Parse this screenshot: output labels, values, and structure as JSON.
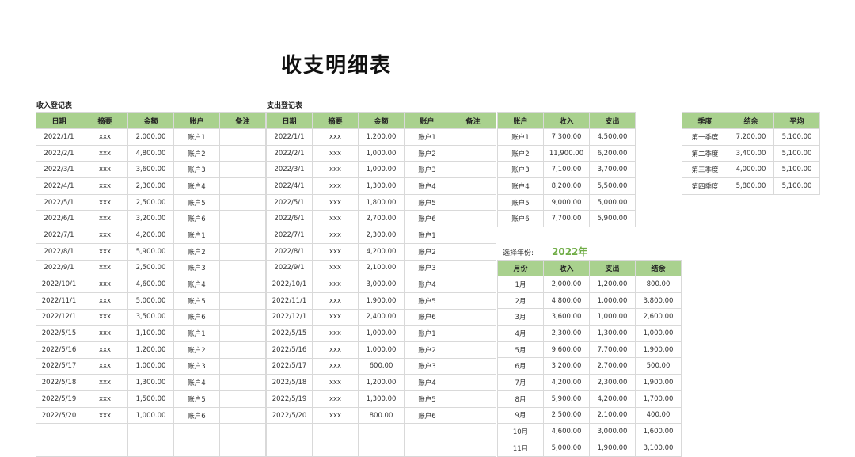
{
  "page_title": "收支明细表",
  "income_table": {
    "label": "收入登记表",
    "headers": [
      "日期",
      "摘要",
      "金额",
      "账户",
      "备注"
    ],
    "rows": [
      [
        "2022/1/1",
        "xxx",
        "2,000.00",
        "账户1",
        ""
      ],
      [
        "2022/2/1",
        "xxx",
        "4,800.00",
        "账户2",
        ""
      ],
      [
        "2022/3/1",
        "xxx",
        "3,600.00",
        "账户3",
        ""
      ],
      [
        "2022/4/1",
        "xxx",
        "2,300.00",
        "账户4",
        ""
      ],
      [
        "2022/5/1",
        "xxx",
        "2,500.00",
        "账户5",
        ""
      ],
      [
        "2022/6/1",
        "xxx",
        "3,200.00",
        "账户6",
        ""
      ],
      [
        "2022/7/1",
        "xxx",
        "4,200.00",
        "账户1",
        ""
      ],
      [
        "2022/8/1",
        "xxx",
        "5,900.00",
        "账户2",
        ""
      ],
      [
        "2022/9/1",
        "xxx",
        "2,500.00",
        "账户3",
        ""
      ],
      [
        "2022/10/1",
        "xxx",
        "4,600.00",
        "账户4",
        ""
      ],
      [
        "2022/11/1",
        "xxx",
        "5,000.00",
        "账户5",
        ""
      ],
      [
        "2022/12/1",
        "xxx",
        "3,500.00",
        "账户6",
        ""
      ],
      [
        "2022/5/15",
        "xxx",
        "1,100.00",
        "账户1",
        ""
      ],
      [
        "2022/5/16",
        "xxx",
        "1,200.00",
        "账户2",
        ""
      ],
      [
        "2022/5/17",
        "xxx",
        "1,000.00",
        "账户3",
        ""
      ],
      [
        "2022/5/18",
        "xxx",
        "1,300.00",
        "账户4",
        ""
      ],
      [
        "2022/5/19",
        "xxx",
        "1,500.00",
        "账户5",
        ""
      ],
      [
        "2022/5/20",
        "xxx",
        "1,000.00",
        "账户6",
        ""
      ],
      [
        "",
        "",
        "",
        "",
        ""
      ],
      [
        "",
        "",
        "",
        "",
        ""
      ]
    ]
  },
  "expense_table": {
    "label": "支出登记表",
    "headers": [
      "日期",
      "摘要",
      "金额",
      "账户",
      "备注"
    ],
    "rows": [
      [
        "2022/1/1",
        "xxx",
        "1,200.00",
        "账户1",
        ""
      ],
      [
        "2022/2/1",
        "xxx",
        "1,000.00",
        "账户2",
        ""
      ],
      [
        "2022/3/1",
        "xxx",
        "1,000.00",
        "账户3",
        ""
      ],
      [
        "2022/4/1",
        "xxx",
        "1,300.00",
        "账户4",
        ""
      ],
      [
        "2022/5/1",
        "xxx",
        "1,800.00",
        "账户5",
        ""
      ],
      [
        "2022/6/1",
        "xxx",
        "2,700.00",
        "账户6",
        ""
      ],
      [
        "2022/7/1",
        "xxx",
        "2,300.00",
        "账户1",
        ""
      ],
      [
        "2022/8/1",
        "xxx",
        "4,200.00",
        "账户2",
        ""
      ],
      [
        "2022/9/1",
        "xxx",
        "2,100.00",
        "账户3",
        ""
      ],
      [
        "2022/10/1",
        "xxx",
        "3,000.00",
        "账户4",
        ""
      ],
      [
        "2022/11/1",
        "xxx",
        "1,900.00",
        "账户5",
        ""
      ],
      [
        "2022/12/1",
        "xxx",
        "2,400.00",
        "账户6",
        ""
      ],
      [
        "2022/5/15",
        "xxx",
        "1,000.00",
        "账户1",
        ""
      ],
      [
        "2022/5/16",
        "xxx",
        "1,000.00",
        "账户2",
        ""
      ],
      [
        "2022/5/17",
        "xxx",
        "600.00",
        "账户3",
        ""
      ],
      [
        "2022/5/18",
        "xxx",
        "1,200.00",
        "账户4",
        ""
      ],
      [
        "2022/5/19",
        "xxx",
        "1,300.00",
        "账户5",
        ""
      ],
      [
        "2022/5/20",
        "xxx",
        "800.00",
        "账户6",
        ""
      ],
      [
        "",
        "",
        "",
        "",
        ""
      ],
      [
        "",
        "",
        "",
        "",
        ""
      ]
    ]
  },
  "account_table": {
    "headers": [
      "账户",
      "收入",
      "支出"
    ],
    "rows": [
      [
        "账户1",
        "7,300.00",
        "4,500.00"
      ],
      [
        "账户2",
        "11,900.00",
        "6,200.00"
      ],
      [
        "账户3",
        "7,100.00",
        "3,700.00"
      ],
      [
        "账户4",
        "8,200.00",
        "5,500.00"
      ],
      [
        "账户5",
        "9,000.00",
        "5,000.00"
      ],
      [
        "账户6",
        "7,700.00",
        "5,900.00"
      ]
    ]
  },
  "quarter_table": {
    "headers": [
      "季度",
      "结余",
      "平均"
    ],
    "rows": [
      [
        "第一季度",
        "7,200.00",
        "5,100.00"
      ],
      [
        "第二季度",
        "3,400.00",
        "5,100.00"
      ],
      [
        "第三季度",
        "4,000.00",
        "5,100.00"
      ],
      [
        "第四季度",
        "5,800.00",
        "5,100.00"
      ]
    ]
  },
  "year_selector": {
    "label": "选择年份:",
    "value": "2022年"
  },
  "monthly_table": {
    "headers": [
      "月份",
      "收入",
      "支出",
      "结余"
    ],
    "rows": [
      [
        "1月",
        "2,000.00",
        "1,200.00",
        "800.00"
      ],
      [
        "2月",
        "4,800.00",
        "1,000.00",
        "3,800.00"
      ],
      [
        "3月",
        "3,600.00",
        "1,000.00",
        "2,600.00"
      ],
      [
        "4月",
        "2,300.00",
        "1,300.00",
        "1,000.00"
      ],
      [
        "5月",
        "9,600.00",
        "7,700.00",
        "1,900.00"
      ],
      [
        "6月",
        "3,200.00",
        "2,700.00",
        "500.00"
      ],
      [
        "7月",
        "4,200.00",
        "2,300.00",
        "1,900.00"
      ],
      [
        "8月",
        "5,900.00",
        "4,200.00",
        "1,700.00"
      ],
      [
        "9月",
        "2,500.00",
        "2,100.00",
        "400.00"
      ],
      [
        "10月",
        "4,600.00",
        "3,000.00",
        "1,600.00"
      ],
      [
        "11月",
        "5,000.00",
        "1,900.00",
        "3,100.00"
      ]
    ]
  },
  "colors": {
    "header_green": "#a9d18e",
    "year_green": "#70ad47",
    "border": "#d9d9d9"
  }
}
